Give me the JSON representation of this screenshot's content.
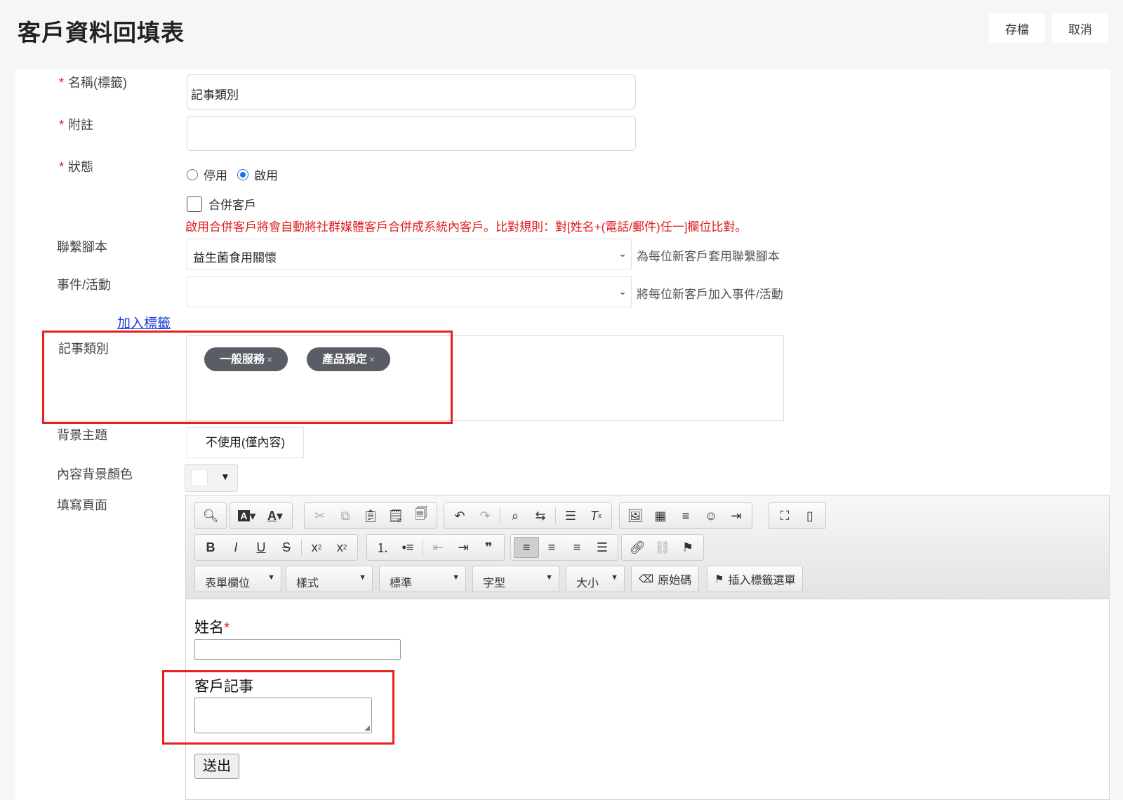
{
  "header": {
    "title": "客戶資料回填表",
    "save_label": "存檔",
    "cancel_label": "取消"
  },
  "form": {
    "name": {
      "label": "名稱(標籤)",
      "value": "記事類別",
      "required": true
    },
    "note": {
      "label": "附註",
      "value": "",
      "required": true
    },
    "status": {
      "label": "狀態",
      "required": true,
      "options": [
        {
          "label": "停用",
          "checked": false
        },
        {
          "label": "啟用",
          "checked": true
        }
      ]
    },
    "merge": {
      "label": "合併客戶",
      "checked": false,
      "note": "啟用合併客戶將會自動將社群媒體客戶合併成系統內客戶。比對規則：對[姓名+(電話/郵件)任一]欄位比對。"
    },
    "script": {
      "label": "聯繫腳本",
      "value": "益生菌食用關懷",
      "hint": "為每位新客戶套用聯繫腳本"
    },
    "event": {
      "label": "事件/活動",
      "value": "",
      "hint": "將每位新客戶加入事件/活動"
    },
    "add_tag_link": "加入標籤",
    "note_category": {
      "label": "記事類別",
      "tags": [
        "一般服務",
        "產品預定"
      ]
    },
    "theme": {
      "label": "背景主題",
      "value": "不使用(僅內容)"
    },
    "bg_color": {
      "label": "內容背景顏色",
      "value": "#ffffff"
    },
    "fill_page": {
      "label": "填寫頁面"
    }
  },
  "editor": {
    "combos": [
      "表單欄位",
      "樣式",
      "標準",
      "字型",
      "大小"
    ],
    "buttons": {
      "source": "原始碼",
      "insert_tag_menu": "插入標籤選單"
    },
    "content": {
      "name_label": "姓名",
      "name_required_mark": "*",
      "note_label": "客戶記事",
      "submit": "送出"
    }
  },
  "colors": {
    "required": "#e02020",
    "radio_active": "#1a73e8",
    "tag_bg": "#5b5d66",
    "highlight_frame": "#e8211d",
    "link": "#1a3cd8"
  }
}
